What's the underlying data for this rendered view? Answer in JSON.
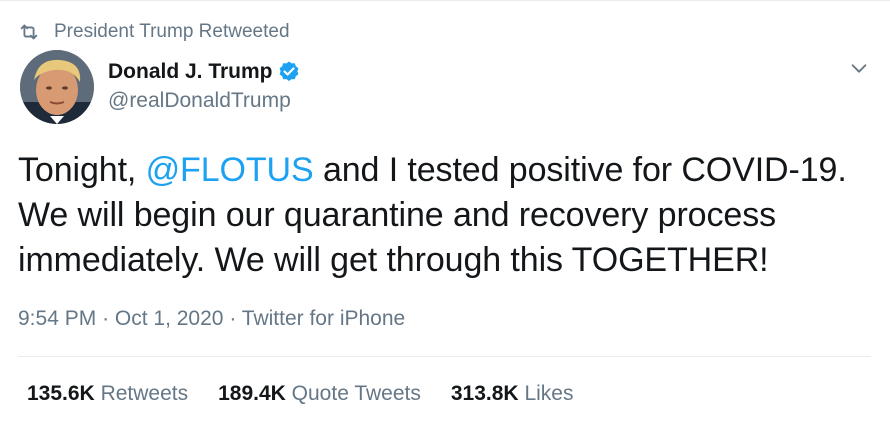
{
  "social_context": {
    "icon": "retweet-icon",
    "text": "President Trump Retweeted"
  },
  "author": {
    "display_name": "Donald J. Trump",
    "handle": "@realDonaldTrump",
    "verified": true,
    "avatar": "avatar-photo"
  },
  "tweet": {
    "text_before": "Tonight, ",
    "mention": "@FLOTUS",
    "text_after": " and I tested positive for COVID-19. We will begin our quarantine and recovery process immediately. We will get through this TOGETHER!"
  },
  "meta": {
    "time": "9:54 PM",
    "date": "Oct 1, 2020",
    "source": "Twitter for iPhone",
    "separator": "·"
  },
  "stats": [
    {
      "count": "135.6K",
      "label": "Retweets"
    },
    {
      "count": "189.4K",
      "label": "Quote Tweets"
    },
    {
      "count": "313.8K",
      "label": "Likes"
    }
  ],
  "colors": {
    "accent": "#1da1f2",
    "secondary_text": "#657786",
    "primary_text": "#14171a",
    "divider": "#e6ecf0"
  }
}
